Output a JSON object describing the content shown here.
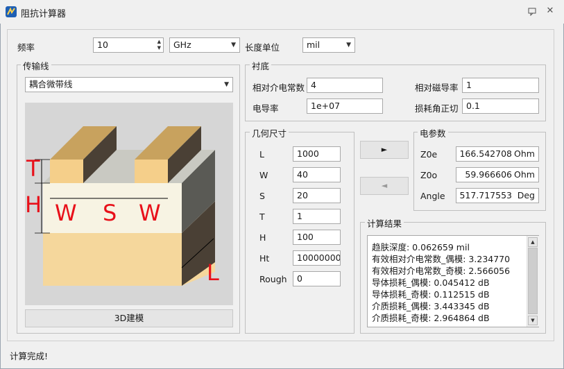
{
  "title": "阻抗计算器",
  "titlebar": {
    "help_icon": "chat-bubble-icon",
    "close_icon": "close-icon"
  },
  "top": {
    "freq_label": "频率",
    "freq_value": "10",
    "freq_unit": "GHz",
    "len_label": "长度单位",
    "len_unit": "mil"
  },
  "tline": {
    "group_title": "传输线",
    "type": "耦合微带线",
    "image_labels": {
      "T": "T",
      "H": "H",
      "W1": "W",
      "S": "S",
      "W2": "W",
      "L": "L"
    },
    "build_button": "3D建模"
  },
  "substrate": {
    "group_title": "衬底",
    "er_label": "相对介电常数",
    "er_value": "4",
    "mur_label": "相对磁导率",
    "mur_value": "1",
    "cond_label": "电导率",
    "cond_value": "1e+07",
    "tand_label": "损耗角正切",
    "tand_value": "0.1"
  },
  "geometry": {
    "group_title": "几何尺寸",
    "params": [
      {
        "label": "L",
        "value": "1000"
      },
      {
        "label": "W",
        "value": "40"
      },
      {
        "label": "S",
        "value": "20"
      },
      {
        "label": "T",
        "value": "1"
      },
      {
        "label": "H",
        "value": "100"
      },
      {
        "label": "Ht",
        "value": "10000000"
      },
      {
        "label": "Rough",
        "value": "0"
      }
    ]
  },
  "arrows": {
    "forward": "►",
    "back": "◄"
  },
  "electrical": {
    "group_title": "电参数",
    "params": [
      {
        "label": "Z0e",
        "value": "166.542708",
        "unit": "Ohm"
      },
      {
        "label": "Z0o",
        "value": "59.966606",
        "unit": "Ohm"
      },
      {
        "label": "Angle",
        "value": "517.717553",
        "unit": "Deg"
      }
    ]
  },
  "results": {
    "group_title": "计算结果",
    "lines": [
      "趋肤深度: 0.062659 mil",
      "有效相对介电常数_偶模: 3.234770",
      "有效相对介电常数_奇模: 2.566056",
      "导体损耗_偶模: 0.045412 dB",
      "导体损耗_奇模: 0.112515 dB",
      "介质损耗_偶模: 3.443345 dB",
      "介质损耗_奇模: 2.964864 dB"
    ]
  },
  "status": "计算完成!"
}
